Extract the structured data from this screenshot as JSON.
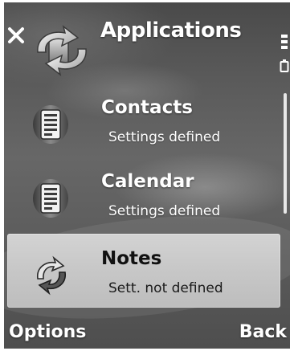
{
  "header": {
    "title": "Applications",
    "close_icon": "close-icon",
    "app_icon": "sync-icon",
    "signal_icon": "signal-indicator-icon"
  },
  "list": {
    "items": [
      {
        "name": "Contacts",
        "status": "Settings defined",
        "icon": "contacts-book-icon",
        "selected": false
      },
      {
        "name": "Calendar",
        "status": "Settings defined",
        "icon": "calendar-book-icon",
        "selected": false
      },
      {
        "name": "Notes",
        "status": "Sett. not defined",
        "icon": "sync-arrows-icon",
        "selected": true
      }
    ]
  },
  "softkeys": {
    "left": "Options",
    "right": "Back"
  },
  "colors": {
    "background": "#5c5c5c",
    "text": "#ffffff",
    "highlight": "#c8c8c8",
    "highlight_text": "#111111"
  }
}
